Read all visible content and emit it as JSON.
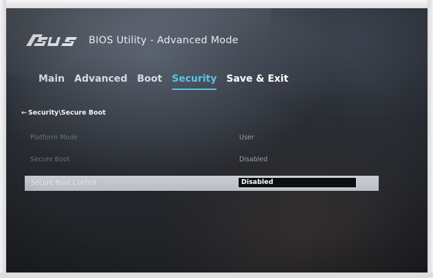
{
  "brand": {
    "logo_text": "/ISUS"
  },
  "header": {
    "title": "BIOS Utility - Advanced Mode"
  },
  "tabs": [
    {
      "label": "Main"
    },
    {
      "label": "Advanced"
    },
    {
      "label": "Boot"
    },
    {
      "label": "Security",
      "active": true
    },
    {
      "label": "Save & Exit"
    }
  ],
  "breadcrumb": {
    "arrow": "←",
    "path": "Security\\Secure Boot"
  },
  "settings": [
    {
      "label": "Platform Mode",
      "value": "User"
    },
    {
      "label": "Secure Boot",
      "value": "Disabled"
    },
    {
      "label": "Secure Boot Control",
      "value": "Disabled"
    }
  ],
  "colors": {
    "accent": "#55c8e6",
    "highlight_bar": "#c0c5cc",
    "value_box": "#0c0e12"
  }
}
